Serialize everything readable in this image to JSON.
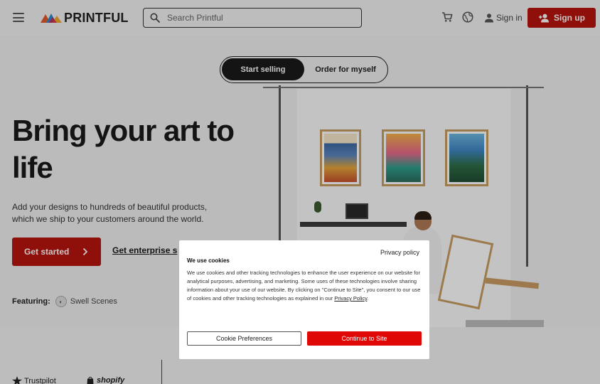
{
  "header": {
    "brand": "PRINTFUL",
    "search_placeholder": "Search Printful",
    "signin_label": "Sign in",
    "signup_label": "Sign up",
    "icons": [
      "menu-icon",
      "search-icon",
      "cart-icon",
      "globe-icon",
      "user-icon",
      "add-user-icon"
    ]
  },
  "hero": {
    "toggle_active": "Start selling",
    "toggle_inactive": "Order for myself",
    "title": "Bring your art to life",
    "description": "Add your designs to hundreds of beautiful products, which we ship to your customers around the world.",
    "cta_label": "Get started",
    "enterprise_label": "Get enterprise s",
    "featuring_label": "Featuring:",
    "featuring_name": "Swell Scenes"
  },
  "cookie_modal": {
    "privacy_link": "Privacy policy",
    "title": "We use cookies",
    "body_before_link": "We use cookies and other tracking technologies to enhance the user experience on our website for analytical purposes, advertising, and marketing. Some uses of these technologies involve sharing information about your use of our website. By clicking on \"Continue to Site\", you consent to our use of cookies and other tracking technologies as explained in our",
    "body_link": "Privacy Policy",
    "body_after_link": ".",
    "preferences_label": "Cookie Preferences",
    "continue_label": "Continue to Site"
  },
  "partners": {
    "trustpilot": "Trustpilot",
    "shopify": "shopify"
  },
  "colors": {
    "brand_red": "#b8140e",
    "continue_red": "#e00707",
    "header_bg": "#f2f2f2",
    "hero_bg": "#f0f0f0"
  }
}
